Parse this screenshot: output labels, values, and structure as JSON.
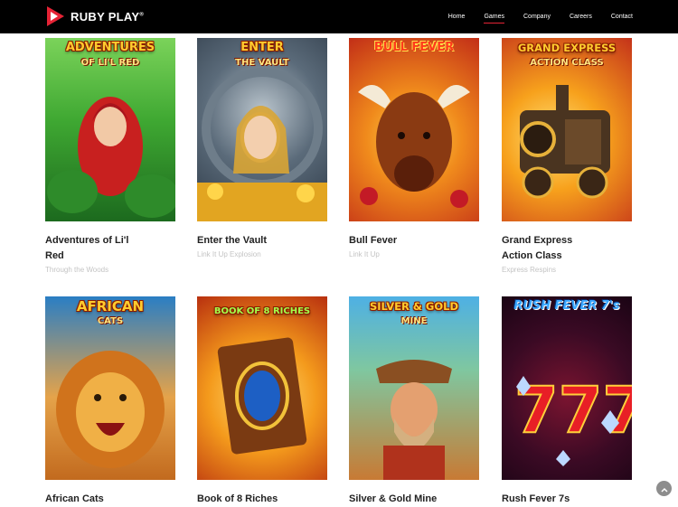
{
  "brand": {
    "name": "RUBY PLAY",
    "registered": "®",
    "color": "#e52335"
  },
  "nav": [
    {
      "label": "Home",
      "active": false
    },
    {
      "label": "Games",
      "active": true
    },
    {
      "label": "Company",
      "active": false
    },
    {
      "label": "Careers",
      "active": false
    },
    {
      "label": "Contact",
      "active": false
    }
  ],
  "games": [
    {
      "title": "Adventures of Li'l Red",
      "subtitle": "Through the Woods",
      "art_title": "ADVENTURES",
      "art_sub": "OF LI'L RED",
      "colors": [
        "#4fb43a",
        "#1c6a1e"
      ]
    },
    {
      "title": "Enter the Vault",
      "subtitle": "Link It Up Explosion",
      "art_title": "ENTER",
      "art_sub": "THE VAULT",
      "colors": [
        "#4a5a6b",
        "#d8a02a"
      ]
    },
    {
      "title": "Bull Fever",
      "subtitle": "Link It Up",
      "art_title": "BULL FEVER",
      "art_sub": "",
      "colors": [
        "#d33d1f",
        "#f6a21a"
      ]
    },
    {
      "title": "Grand Express Action Class",
      "subtitle": "Express Respins",
      "art_title": "GRAND EXPRESS",
      "art_sub": "ACTION CLASS",
      "colors": [
        "#c8381a",
        "#f9b233"
      ]
    },
    {
      "title": "African Cats",
      "subtitle": "",
      "art_title": "AFRICAN",
      "art_sub": "CATS",
      "colors": [
        "#2f86c9",
        "#e0892a"
      ]
    },
    {
      "title": "Book of 8 Riches",
      "subtitle": "",
      "art_title": "BOOK OF 8 RICHES",
      "art_sub": "",
      "colors": [
        "#d94a12",
        "#f7b51f"
      ]
    },
    {
      "title": "Silver & Gold Mine",
      "subtitle": "",
      "art_title": "SILVER & GOLD",
      "art_sub": "MINE",
      "colors": [
        "#5fb4e0",
        "#d0702a"
      ]
    },
    {
      "title": "Rush Fever 7s",
      "subtitle": "",
      "art_title": "RUSH FEVER 7's",
      "art_sub": "",
      "colors": [
        "#2a0a2e",
        "#b31320"
      ]
    }
  ],
  "scroll_top_icon": "chevron-up-icon"
}
